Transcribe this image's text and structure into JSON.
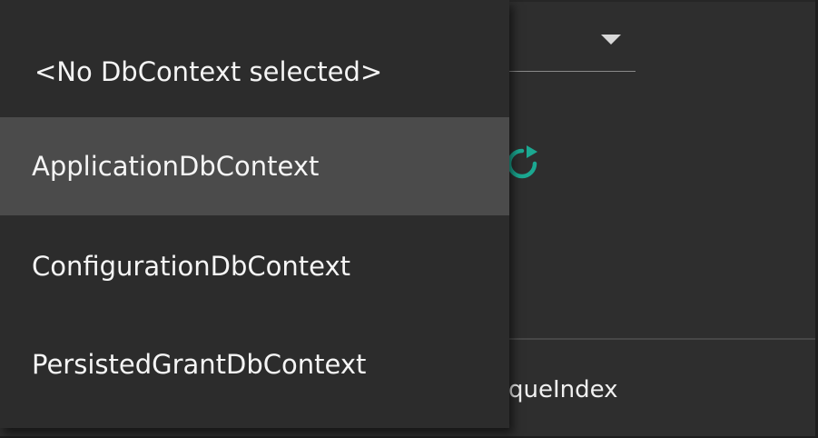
{
  "combo": {
    "arrow_icon": "chevron-down-icon"
  },
  "refresh": {
    "icon": "refresh-icon",
    "color": "#1ba891"
  },
  "grid": {
    "visible_cell_text": "queIndex"
  },
  "dropdown": {
    "items": [
      {
        "label": "<No DbContext selected>"
      },
      {
        "label": "ApplicationDbContext"
      },
      {
        "label": "ConfigurationDbContext"
      },
      {
        "label": "PersistedGrantDbContext"
      }
    ],
    "highlighted_index": 1,
    "highlight_color": "#4b4b4b"
  }
}
